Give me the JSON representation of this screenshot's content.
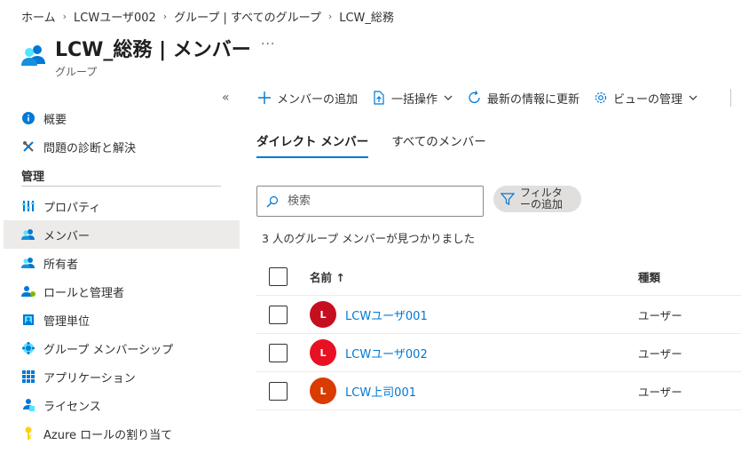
{
  "breadcrumb": [
    "ホーム",
    "LCWユーザ002",
    "グループ | すべてのグループ",
    "LCW_総務"
  ],
  "title": "LCW_総務 | メンバー",
  "subtitle": "グループ",
  "more": "...",
  "collapse": "«",
  "sidebar": {
    "items_top": [
      {
        "label": "概要",
        "icon": "info-icon"
      },
      {
        "label": "問題の診断と解決",
        "icon": "wrench-icon"
      }
    ],
    "heading": "管理",
    "items": [
      {
        "label": "プロパティ",
        "icon": "properties-icon"
      },
      {
        "label": "メンバー",
        "icon": "members-icon"
      },
      {
        "label": "所有者",
        "icon": "owners-icon"
      },
      {
        "label": "ロールと管理者",
        "icon": "roles-icon"
      },
      {
        "label": "管理単位",
        "icon": "admin-units-icon"
      },
      {
        "label": "グループ メンバーシップ",
        "icon": "group-membership-icon"
      },
      {
        "label": "アプリケーション",
        "icon": "applications-icon"
      },
      {
        "label": "ライセンス",
        "icon": "licenses-icon"
      },
      {
        "label": "Azure ロールの割り当て",
        "icon": "key-icon"
      }
    ]
  },
  "toolbar": {
    "add_member": "メンバーの追加",
    "bulk": "一括操作",
    "refresh": "最新の情報に更新",
    "view": "ビューの管理"
  },
  "tabs": [
    "ダイレクト メンバー",
    "すべてのメンバー"
  ],
  "search": {
    "placeholder": "検索"
  },
  "filter": {
    "line1": "フィルタ",
    "line2": "ーの追加"
  },
  "count_text": "3 人のグループ メンバーが見つかりました",
  "table": {
    "col_name": "名前 ↑",
    "col_type": "種類",
    "rows": [
      {
        "initial": "L",
        "name": "LCWユーザ001",
        "type": "ユーザー",
        "color": "#c50f1f"
      },
      {
        "initial": "L",
        "name": "LCWユーザ002",
        "type": "ユーザー",
        "color": "#e81123"
      },
      {
        "initial": "L",
        "name": "LCW上司001",
        "type": "ユーザー",
        "color": "#da3b01"
      }
    ]
  },
  "colors": {
    "accent": "#0078d4"
  }
}
